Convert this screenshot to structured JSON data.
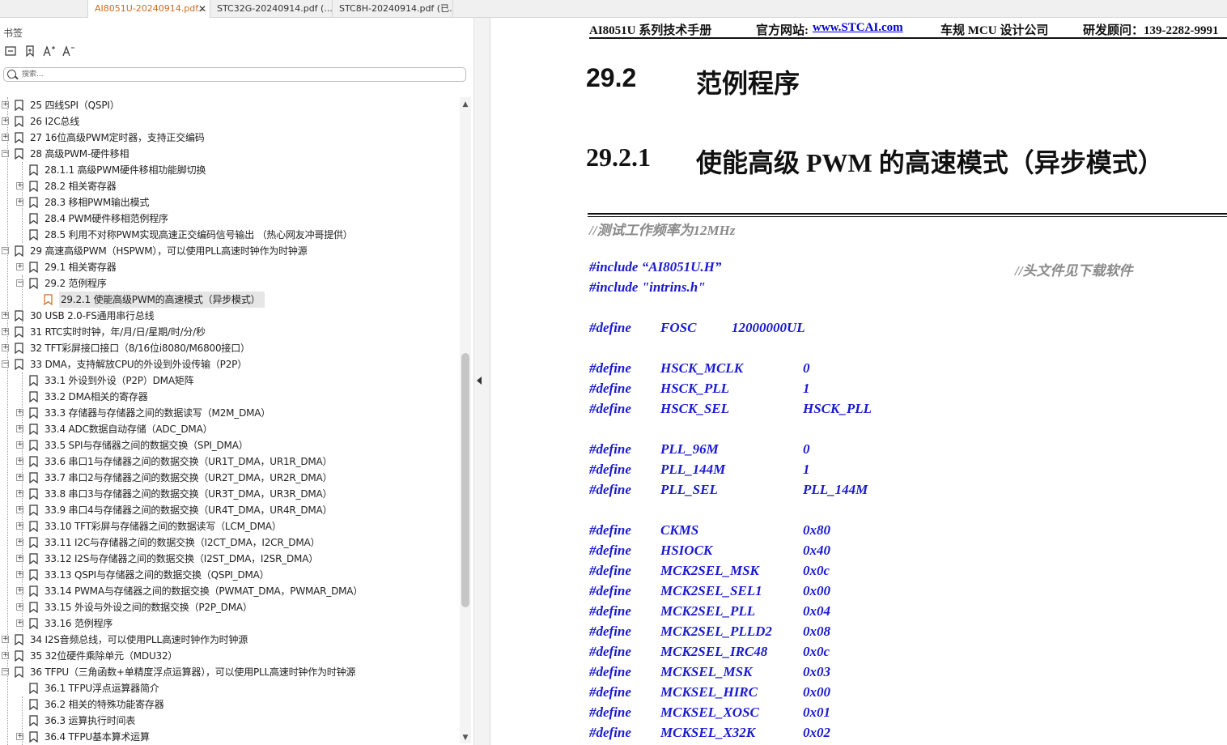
{
  "tabs": [
    {
      "label": "AI8051U-20240914.pdf...",
      "active": true,
      "close": "✕"
    },
    {
      "label": "STC32G-20240914.pdf (...",
      "active": false
    },
    {
      "label": "STC8H-20240914.pdf (已...",
      "active": false
    }
  ],
  "sidebar": {
    "title": "书签",
    "search_placeholder": "搜索...",
    "tree": [
      {
        "level": 0,
        "toggle": "+",
        "label": "25  四线SPI（QSPI）"
      },
      {
        "level": 0,
        "toggle": "+",
        "label": "26  I2C总线"
      },
      {
        "level": 0,
        "toggle": "+",
        "label": "27  16位高级PWM定时器，支持正交编码"
      },
      {
        "level": 0,
        "toggle": "−",
        "label": "28  高级PWM-硬件移相"
      },
      {
        "level": 1,
        "toggle": "",
        "label": "28.1.1 高级PWM硬件移相功能脚切换"
      },
      {
        "level": 1,
        "toggle": "+",
        "label": "28.2  相关寄存器"
      },
      {
        "level": 1,
        "toggle": "+",
        "label": "28.3  移相PWM输出模式"
      },
      {
        "level": 1,
        "toggle": "",
        "label": "28.4  PWM硬件移相范例程序"
      },
      {
        "level": 1,
        "toggle": "",
        "label": "28.5 利用不对称PWM实现高速正交编码信号输出 （热心网友冲哥提供）"
      },
      {
        "level": 0,
        "toggle": "−",
        "label": "29  高速高级PWM（HSPWM），可以使用PLL高速时钟作为时钟源"
      },
      {
        "level": 1,
        "toggle": "+",
        "label": "29.1 相关寄存器"
      },
      {
        "level": 1,
        "toggle": "−",
        "label": "29.2  范例程序"
      },
      {
        "level": 2,
        "toggle": "",
        "label": "29.2.1 使能高级PWM的高速模式（异步模式）",
        "selected": true
      },
      {
        "level": 0,
        "toggle": "+",
        "label": "30  USB 2.0-FS通用串行总线"
      },
      {
        "level": 0,
        "toggle": "+",
        "label": "31  RTC实时时钟，年/月/日/星期/时/分/秒"
      },
      {
        "level": 0,
        "toggle": "+",
        "label": "32  TFT彩屏接口接口（8/16位i8080/M6800接口）"
      },
      {
        "level": 0,
        "toggle": "−",
        "label": "33  DMA，支持解放CPU的外设到外设传输（P2P）"
      },
      {
        "level": 1,
        "toggle": "",
        "label": "33.1  外设到外设（P2P）DMA矩阵"
      },
      {
        "level": 1,
        "toggle": "",
        "label": "33.2  DMA相关的寄存器"
      },
      {
        "level": 1,
        "toggle": "+",
        "label": "33.3  存储器与存储器之间的数据读写（M2M_DMA）"
      },
      {
        "level": 1,
        "toggle": "+",
        "label": "33.4  ADC数据自动存储（ADC_DMA）"
      },
      {
        "level": 1,
        "toggle": "+",
        "label": "33.5  SPI与存储器之间的数据交换（SPI_DMA）"
      },
      {
        "level": 1,
        "toggle": "+",
        "label": "33.6  串口1与存储器之间的数据交换（UR1T_DMA，UR1R_DMA）"
      },
      {
        "level": 1,
        "toggle": "+",
        "label": "33.7  串口2与存储器之间的数据交换（UR2T_DMA，UR2R_DMA）"
      },
      {
        "level": 1,
        "toggle": "+",
        "label": "33.8  串口3与存储器之间的数据交换（UR3T_DMA，UR3R_DMA）"
      },
      {
        "level": 1,
        "toggle": "+",
        "label": "33.9  串口4与存储器之间的数据交换（UR4T_DMA，UR4R_DMA）"
      },
      {
        "level": 1,
        "toggle": "+",
        "label": "33.10  TFT彩屏与存储器之间的数据读写（LCM_DMA）"
      },
      {
        "level": 1,
        "toggle": "+",
        "label": "33.11  I2C与存储器之间的数据交换（I2CT_DMA，I2CR_DMA）"
      },
      {
        "level": 1,
        "toggle": "+",
        "label": "33.12  I2S与存储器之间的数据交换（I2ST_DMA，I2SR_DMA）"
      },
      {
        "level": 1,
        "toggle": "+",
        "label": "33.13  QSPI与存储器之间的数据交换（QSPI_DMA）"
      },
      {
        "level": 1,
        "toggle": "+",
        "label": "33.14  PWMA与存储器之间的数据交换（PWMAT_DMA，PWMAR_DMA）"
      },
      {
        "level": 1,
        "toggle": "+",
        "label": "33.15  外设与外设之间的数据交换（P2P_DMA）"
      },
      {
        "level": 1,
        "toggle": "+",
        "label": "33.16  范例程序"
      },
      {
        "level": 0,
        "toggle": "+",
        "label": "34  I2S音频总线，可以使用PLL高速时钟作为时钟源"
      },
      {
        "level": 0,
        "toggle": "+",
        "label": "35  32位硬件乘除单元（MDU32）"
      },
      {
        "level": 0,
        "toggle": "−",
        "label": "36  TFPU（三角函数+单精度浮点运算器），可以使用PLL高速时钟作为时钟源"
      },
      {
        "level": 1,
        "toggle": "",
        "label": "36.1 TFPU浮点运算器简介"
      },
      {
        "level": 1,
        "toggle": "",
        "label": "36.2 相关的特殊功能寄存器"
      },
      {
        "level": 1,
        "toggle": "",
        "label": "36.3  运算执行时间表"
      },
      {
        "level": 1,
        "toggle": "+",
        "label": "36.4  TFPU基本算术运算"
      }
    ]
  },
  "document": {
    "header": {
      "manual": "AI8051U 系列技术手册",
      "site_label": "官方网站:",
      "site_url": "www.STCAI.com",
      "company": "车规 MCU 设计公司",
      "consultant": "研发顾问：139-2282-9991"
    },
    "section": {
      "number": "29.2",
      "title": "范例程序"
    },
    "subsection": {
      "number": "29.2.1",
      "title": "使能高级 PWM 的高速模式（异步模式）"
    },
    "code_comment_top": "//测试工作频率为12MHz",
    "include_lines": [
      {
        "text": "#include “AI8051U.H”",
        "comment": "//头文件见下载软件"
      },
      {
        "text": "#include \"intrins.h\"",
        "comment": ""
      }
    ],
    "defines": [
      {
        "group": 0,
        "kw": "#define",
        "name": "FOSC",
        "value": "12000000UL"
      },
      {
        "group": 1,
        "kw": "#define",
        "name": "HSCK_MCLK",
        "value": "0"
      },
      {
        "group": 1,
        "kw": "#define",
        "name": "HSCK_PLL",
        "value": "1"
      },
      {
        "group": 1,
        "kw": "#define",
        "name": "HSCK_SEL",
        "value": "HSCK_PLL"
      },
      {
        "group": 2,
        "kw": "#define",
        "name": "PLL_96M",
        "value": "0"
      },
      {
        "group": 2,
        "kw": "#define",
        "name": "PLL_144M",
        "value": "1"
      },
      {
        "group": 2,
        "kw": "#define",
        "name": "PLL_SEL",
        "value": "PLL_144M"
      },
      {
        "group": 3,
        "kw": "#define",
        "name": "CKMS",
        "value": "0x80"
      },
      {
        "group": 3,
        "kw": "#define",
        "name": "HSIOCK",
        "value": "0x40"
      },
      {
        "group": 3,
        "kw": "#define",
        "name": "MCK2SEL_MSK",
        "value": "0x0c"
      },
      {
        "group": 3,
        "kw": "#define",
        "name": "MCK2SEL_SEL1",
        "value": "0x00"
      },
      {
        "group": 3,
        "kw": "#define",
        "name": "MCK2SEL_PLL",
        "value": "0x04"
      },
      {
        "group": 3,
        "kw": "#define",
        "name": "MCK2SEL_PLLD2",
        "value": "0x08"
      },
      {
        "group": 3,
        "kw": "#define",
        "name": "MCK2SEL_IRC48",
        "value": "0x0c"
      },
      {
        "group": 3,
        "kw": "#define",
        "name": "MCKSEL_MSK",
        "value": "0x03"
      },
      {
        "group": 3,
        "kw": "#define",
        "name": "MCKSEL_HIRC",
        "value": "0x00"
      },
      {
        "group": 3,
        "kw": "#define",
        "name": "MCKSEL_XOSC",
        "value": "0x01"
      },
      {
        "group": 3,
        "kw": "#define",
        "name": "MCKSEL_X32K",
        "value": "0x02"
      }
    ]
  },
  "colors": {
    "code": "#1a1ad0",
    "comment": "#8a8a8a",
    "active_tab": "#d2691e",
    "link": "#0000cc"
  }
}
